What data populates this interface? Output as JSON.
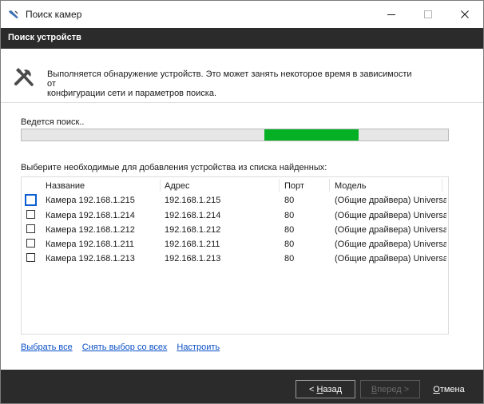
{
  "window": {
    "title": "Поиск камер",
    "controls": {
      "minimize": "–",
      "maximize": "□",
      "close": "✕"
    }
  },
  "header": {
    "title": "Поиск устройств"
  },
  "intro": {
    "icon": "tools-icon",
    "line1": "Выполняется обнаружение устройств. Это может занять некоторое время в зависимости от",
    "line2": "конфигурации сети и параметров поиска."
  },
  "search": {
    "status": "Ведется поиск..",
    "progress_indicator": "marquee",
    "progress_segment": {
      "start": 0.57,
      "end": 0.79
    },
    "progress_color": "#06b025"
  },
  "list": {
    "caption": "Выберите необходимые для добавления устройства из списка найденных:",
    "columns": [
      "Название",
      "Адрес",
      "Порт",
      "Модель"
    ],
    "rows": [
      {
        "name": "Камера 192.168.1.215",
        "address": "192.168.1.215",
        "port": "80",
        "model": "(Общие драйвера) Universal ...",
        "checked": false
      },
      {
        "name": "Камера 192.168.1.214",
        "address": "192.168.1.214",
        "port": "80",
        "model": "(Общие драйвера) Universal ...",
        "checked": false
      },
      {
        "name": "Камера 192.168.1.212",
        "address": "192.168.1.212",
        "port": "80",
        "model": "(Общие драйвера) Universal ...",
        "checked": false
      },
      {
        "name": "Камера 192.168.1.211",
        "address": "192.168.1.211",
        "port": "80",
        "model": "(Общие драйвера) Universal ...",
        "checked": false
      },
      {
        "name": "Камера 192.168.1.213",
        "address": "192.168.1.213",
        "port": "80",
        "model": "(Общие драйвера) Universal ...",
        "checked": false
      }
    ]
  },
  "links": {
    "select_all": "Выбрать все",
    "deselect_all": "Снять выбор со всех",
    "configure": "Настроить"
  },
  "footer": {
    "back": {
      "pre": "< ",
      "key": "Н",
      "rest": "азад"
    },
    "next": {
      "pre": "",
      "key": "В",
      "rest": "перед >"
    },
    "cancel": {
      "pre": "",
      "key": "О",
      "rest": "тмена"
    }
  },
  "colors": {
    "header_bg": "#2b2b2b",
    "link": "#0b50c8",
    "focus": "#0a5ecf"
  }
}
